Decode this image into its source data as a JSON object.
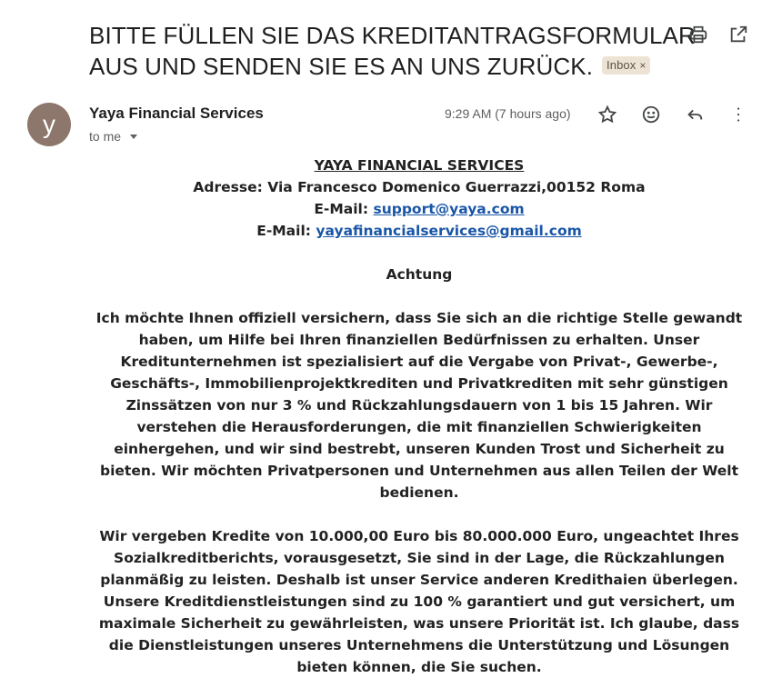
{
  "subject": {
    "line1": "BITTE FÜLLEN SIE DAS KREDITANTRAGSFORMULAR",
    "line2": "AUS UND SENDEN SIE ES AN UNS ZURÜCK.",
    "label": "Inbox",
    "label_close": "×"
  },
  "toolbar_icons": [
    "print-icon",
    "open-in-new-window-icon"
  ],
  "message": {
    "avatar_letter": "y",
    "avatar_color": "#8d766b",
    "sender": "Yaya Financial Services",
    "recipient": "to me",
    "time": "9:29 AM (7 hours ago)",
    "action_icons": [
      "star-icon",
      "emoji-icon",
      "reply-icon",
      "more-vert-icon"
    ]
  },
  "body": {
    "company": "YAYA FINANCIAL SERVICES",
    "address": "Adresse: Via Francesco Domenico Guerrazzi,00152 Roma",
    "email_label": "E-Mail:",
    "email1": "support@yaya.com",
    "email2": "yayafinancialservices@gmail.com",
    "heading": "Achtung",
    "paragraph1": "Ich möchte Ihnen offiziell versichern, dass Sie sich an die richtige Stelle gewandt haben, um Hilfe bei Ihren finanziellen Bedürfnissen zu erhalten. Unser Kreditunternehmen ist spezialisiert auf die Vergabe von Privat-, Gewerbe-, Geschäfts-, Immobilienprojektkrediten und Privatkrediten mit sehr günstigen Zinssätzen von nur 3 % und Rückzahlungsdauern von 1 bis 15 Jahren. Wir verstehen die Herausforderungen, die mit finanziellen Schwierigkeiten einhergehen, und wir sind bestrebt, unseren Kunden Trost und Sicherheit zu bieten. Wir möchten Privatpersonen und Unternehmen aus allen Teilen der Welt bedienen.",
    "paragraph2": "Wir vergeben Kredite von 10.000,00 Euro bis 80.000.000 Euro, ungeachtet Ihres Sozialkreditberichts, vorausgesetzt, Sie sind in der Lage, die Rückzahlungen planmäßig zu leisten. Deshalb ist unser Service anderen Kredithaien überlegen. Unsere Kreditdienstleistungen sind zu 100 % garantiert und gut versichert, um maximale Sicherheit zu gewährleisten, was unsere Priorität ist. Ich glaube, dass die Dienstleistungen unseres Unternehmens die Unterstützung und Lösungen bieten können, die Sie suchen."
  }
}
